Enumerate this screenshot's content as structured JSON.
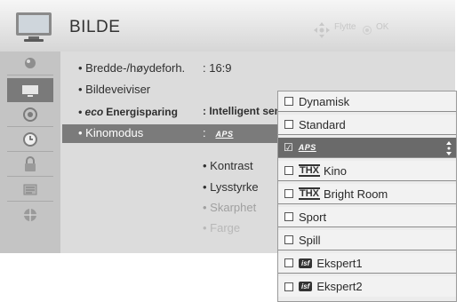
{
  "header": {
    "title": "BILDE",
    "hint_move": "Flytte",
    "hint_ok": "OK"
  },
  "sidebar": {
    "items": [
      {
        "icon": "picture-icon"
      },
      {
        "icon": "tv-icon"
      },
      {
        "icon": "speaker-icon"
      },
      {
        "icon": "clock-icon"
      },
      {
        "icon": "lock-icon"
      },
      {
        "icon": "options-icon"
      },
      {
        "icon": "network-icon"
      }
    ]
  },
  "settings": [
    {
      "label": "• Bredde-/høydeforh.",
      "value": ": 16:9"
    },
    {
      "label": "• Bildeveiviser",
      "value": ""
    },
    {
      "label": "Energisparing",
      "value": ": Intelligent sen"
    },
    {
      "label": "• Kinomodus",
      "value": ":"
    }
  ],
  "energy_prefix": "• eco",
  "subsettings": [
    "• Kontrast",
    "• Lysstyrke",
    "• Skarphet",
    "• Farge"
  ],
  "dropdown": {
    "options": [
      {
        "label": "Dynamisk"
      },
      {
        "label": "Standard"
      },
      {
        "label": "APS",
        "selected": true
      },
      {
        "label": "Kino",
        "logo": "THX"
      },
      {
        "label": "Bright Room",
        "logo": "THX"
      },
      {
        "label": "Sport"
      },
      {
        "label": "Spill"
      },
      {
        "label": "Ekspert1",
        "logo": "isf"
      },
      {
        "label": "Ekspert2",
        "logo": "isf"
      }
    ],
    "selected_mark": "☑"
  },
  "colors": {
    "highlight": "#7b7b7b",
    "selected_option": "#5f5f5f",
    "panel": "#dcdcdc"
  }
}
